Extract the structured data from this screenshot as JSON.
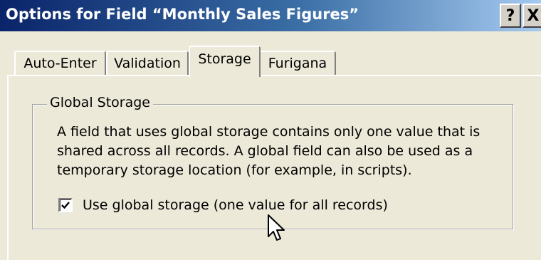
{
  "window": {
    "title": "Options for Field “Monthly Sales Figures”",
    "help_label": "?",
    "close_label": "X"
  },
  "tabs": [
    {
      "label": "Auto-Enter",
      "selected": false
    },
    {
      "label": "Validation",
      "selected": false
    },
    {
      "label": "Storage",
      "selected": true
    },
    {
      "label": "Furigana",
      "selected": false
    }
  ],
  "global_storage": {
    "group_label": "Global Storage",
    "description_lines": [
      "A field that uses global storage contains only one value that is",
      "shared across all records.  A global field can also be used as a",
      "temporary storage location (for example, in scripts)."
    ],
    "checkbox_label": "Use global storage (one value for all records)",
    "checkbox_checked": true
  },
  "icons": {
    "checkmark": "checkmark-icon",
    "cursor": "mouse-pointer-icon"
  },
  "colors": {
    "title_bar_start": "#0a246a",
    "title_bar_end": "#a6caf0",
    "dialog_bg": "#ece9d8"
  }
}
